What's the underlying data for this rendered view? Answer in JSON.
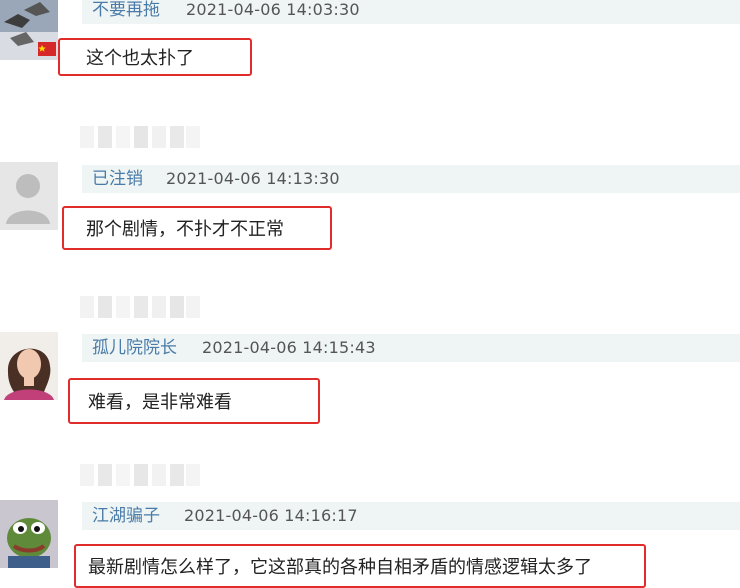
{
  "colors": {
    "username": "#4a7ba8",
    "highlight_border": "#e12c2c",
    "header_bg": "#eef5f4"
  },
  "comments": [
    {
      "username": "不要再拖",
      "timestamp": "2021-04-06 14:03:30",
      "text": "这个也太扑了",
      "avatar_icon": "birds-flag-avatar-icon"
    },
    {
      "username": "已注销",
      "timestamp": "2021-04-06 14:13:30",
      "text": "那个剧情，不扑才不正常",
      "avatar_icon": "default-user-avatar-icon"
    },
    {
      "username": "孤儿院院长",
      "timestamp": "2021-04-06 14:15:43",
      "text": "难看，是非常难看",
      "avatar_icon": "woman-photo-avatar-icon"
    },
    {
      "username": "江湖骗子",
      "timestamp": "2021-04-06 14:16:17",
      "text": "最新剧情怎么样了，它这部真的各种自相矛盾的情感逻辑太多了",
      "avatar_icon": "pepe-frog-avatar-icon"
    }
  ]
}
